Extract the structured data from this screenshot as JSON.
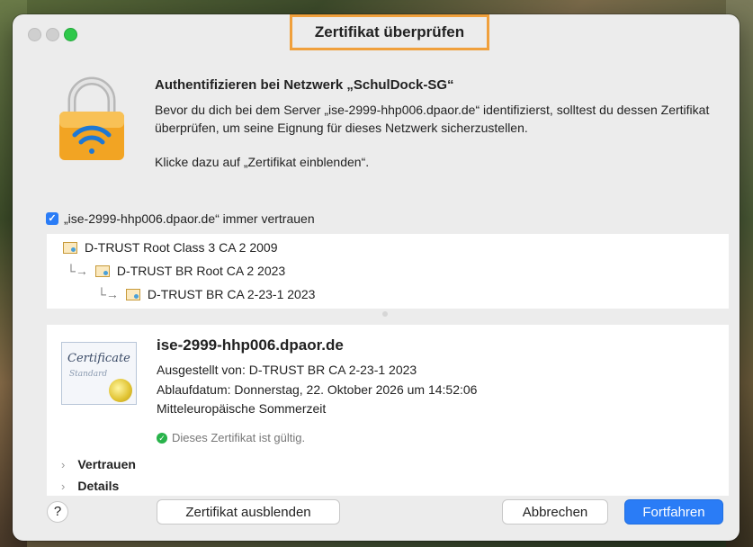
{
  "window": {
    "title": "Zertifikat überprüfen"
  },
  "header": {
    "heading": "Authentifizieren bei Netzwerk „SchulDock-SG“",
    "description": "Bevor du dich bei dem Server „ise-2999-hhp006.dpaor.de“ identifizierst, solltest du dessen Zertifikat überprüfen, um seine Eignung für dieses Netzwerk sicherzustellen.",
    "hint": "Klicke dazu auf „Zertifikat einblenden“."
  },
  "trust": {
    "checked": true,
    "label": "„ise-2999-hhp006.dpaor.de“ immer vertrauen"
  },
  "chain": [
    {
      "label": "D-TRUST Root Class 3 CA 2 2009",
      "arrow": ""
    },
    {
      "label": "D-TRUST BR Root CA 2 2023",
      "arrow": "└→"
    },
    {
      "label": "D-TRUST BR CA 2-23-1 2023",
      "arrow": "└→"
    }
  ],
  "certificate": {
    "image_text_1": "Certificate",
    "image_text_2": "Standard",
    "name": "ise-2999-hhp006.dpaor.de",
    "issued_by": "Ausgestellt von: D-TRUST BR CA 2-23-1 2023",
    "expires": "Ablaufdatum: Donnerstag, 22. Oktober 2026 um 14:52:06",
    "timezone": "Mitteleuropäische Sommerzeit",
    "status": "Dieses Zertifikat ist gültig.",
    "sections": [
      "Vertrauen",
      "Details"
    ]
  },
  "buttons": {
    "help": "?",
    "hide_certificate": "Zertifikat ausblenden",
    "cancel": "Abbrechen",
    "continue": "Fortfahren"
  },
  "colors": {
    "accent": "#2a7cf6",
    "title_highlight": "#f0a03c",
    "valid_green": "#28b34a"
  }
}
